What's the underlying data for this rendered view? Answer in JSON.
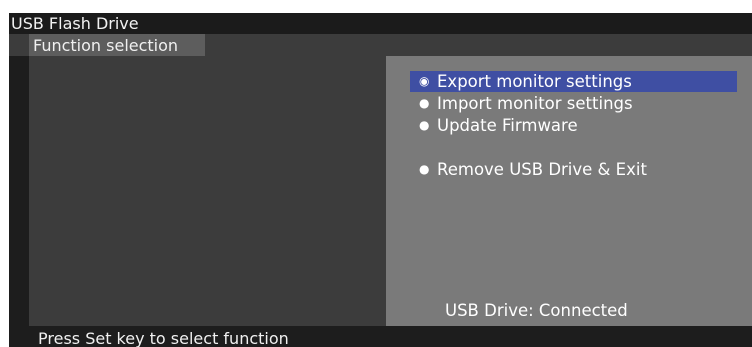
{
  "title": "USB Flash Drive",
  "section": "Function selection",
  "menu": {
    "selected_index": 0,
    "items": [
      {
        "label": "Export monitor settings",
        "bullet": "◉"
      },
      {
        "label": "Import monitor settings",
        "bullet": "●"
      },
      {
        "label": "Update Firmware",
        "bullet": "●"
      },
      {
        "label": "Remove USB Drive & Exit",
        "bullet": "●"
      }
    ]
  },
  "status": "USB Drive: Connected",
  "footer": "Press Set key to select function",
  "colors": {
    "selection": "#3f4fa3",
    "title_bar": "#1b1b1b",
    "left_pane": "#3c3c3c",
    "right_pane": "#7a7a7a"
  }
}
